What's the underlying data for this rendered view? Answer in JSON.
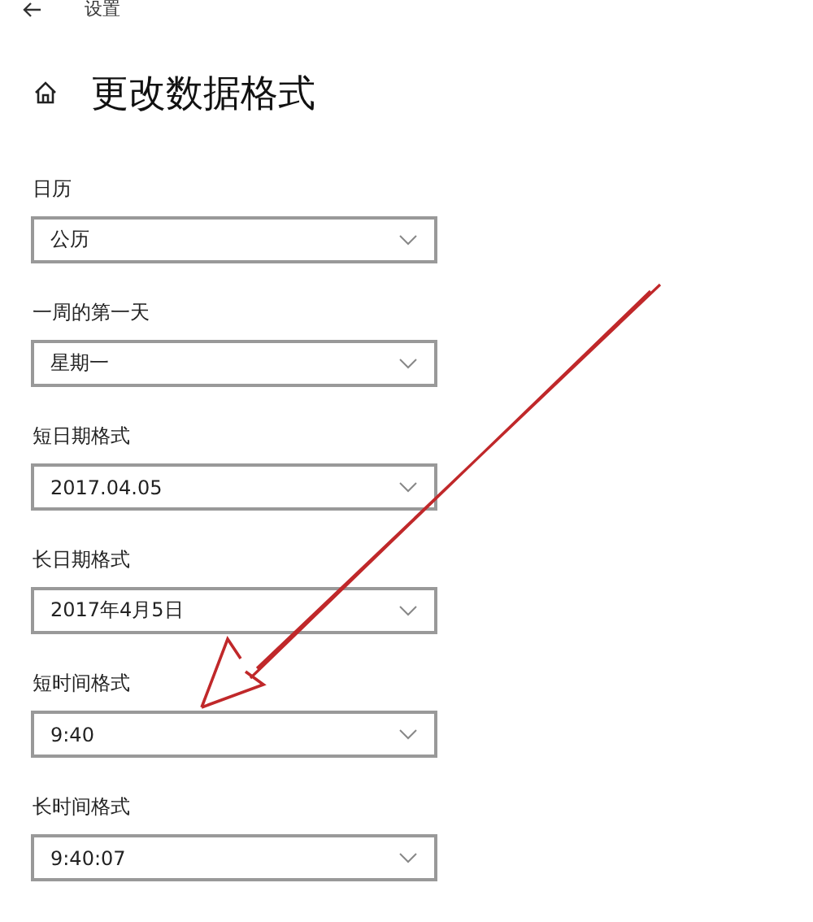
{
  "window": {
    "title": "设置"
  },
  "page": {
    "title": "更改数据格式"
  },
  "fields": [
    {
      "label": "日历",
      "value": "公历"
    },
    {
      "label": "一周的第一天",
      "value": "星期一"
    },
    {
      "label": "短日期格式",
      "value": "2017.04.05"
    },
    {
      "label": "长日期格式",
      "value": "2017年4月5日"
    },
    {
      "label": "短时间格式",
      "value": "9:40"
    },
    {
      "label": "长时间格式",
      "value": "9:40:07"
    }
  ]
}
